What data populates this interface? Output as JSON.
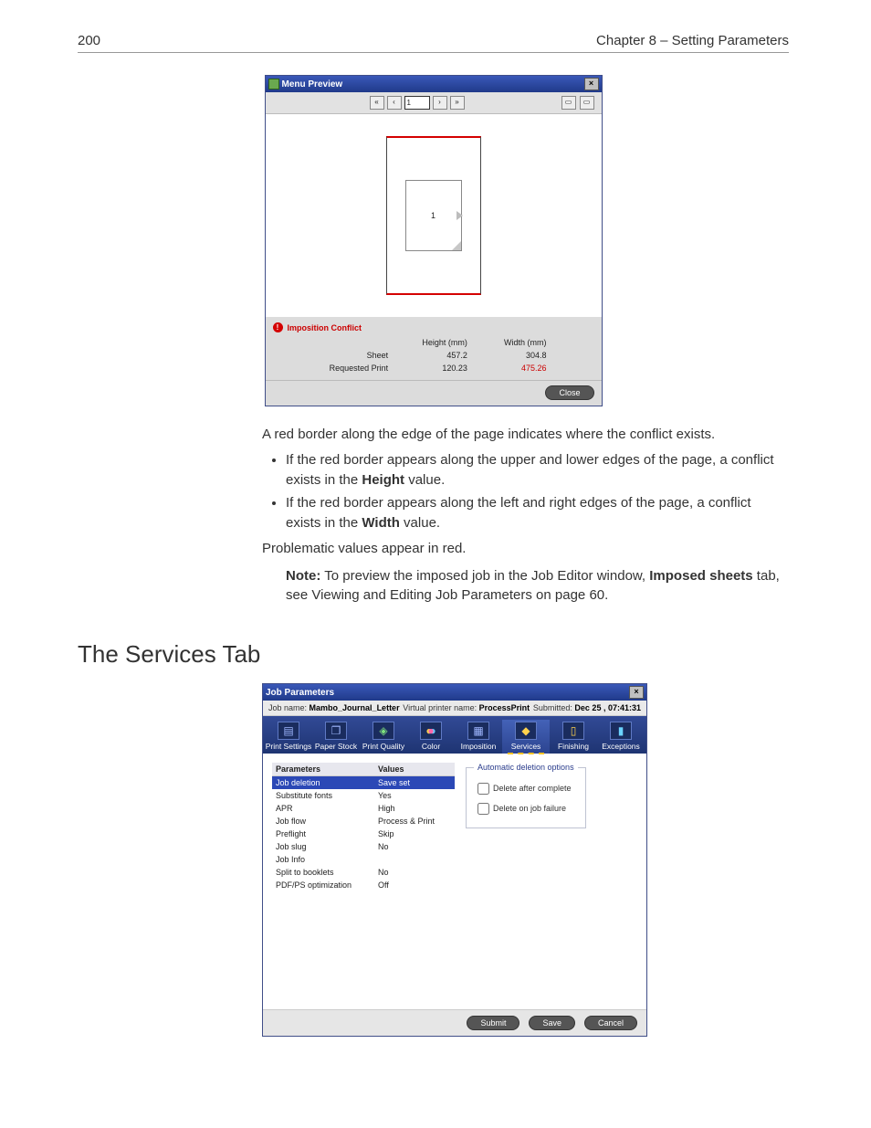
{
  "header": {
    "page_number": "200",
    "chapter": "Chapter 8 – Setting Parameters"
  },
  "preview": {
    "title": "Menu Preview",
    "page_field": "1",
    "sheet_label": "1",
    "conflict_label": "Imposition Conflict",
    "columns": {
      "h": "Height (mm)",
      "w": "Width (mm)"
    },
    "rows": {
      "sheet": {
        "label": "Sheet",
        "h": "457.2",
        "w": "304.8"
      },
      "requested": {
        "label": "Requested Print",
        "h": "120.23",
        "w": "475.26"
      }
    },
    "close": "Close"
  },
  "body": {
    "p1": "A red border along the edge of the page indicates where the conflict exists.",
    "b1a": "If the red border appears along the upper and lower edges of the page, a conflict exists in the ",
    "b1b": "Height",
    "b1c": " value.",
    "b2a": "If the red border appears along the left and right edges of the page, a conflict exists in the ",
    "b2b": "Width",
    "b2c": " value.",
    "p2": "Problematic values appear in red.",
    "note_lead": "Note:",
    "note_a": "  To preview the imposed job in the Job Editor window, ",
    "note_b": "Imposed sheets",
    "note_c": " tab, see Viewing and Editing Job Parameters on page 60."
  },
  "section_heading": "The Services Tab",
  "params": {
    "title": "Job Parameters",
    "info": {
      "jobname_lbl": "Job name:",
      "jobname": "Mambo_Journal_Letter",
      "vp_lbl": "Virtual printer name:",
      "vp": "ProcessPrint",
      "sub_lbl": "Submitted:",
      "sub": "Dec 25 , 07:41:31"
    },
    "tabs": [
      "Print Settings",
      "Paper Stock",
      "Print Quality",
      "Color",
      "Imposition",
      "Services",
      "Finishing",
      "Exceptions"
    ],
    "table": {
      "head_p": "Parameters",
      "head_v": "Values",
      "rows": [
        {
          "p": "Job deletion",
          "v": "Save set",
          "sel": true
        },
        {
          "p": "Substitute fonts",
          "v": "Yes"
        },
        {
          "p": "APR",
          "v": "High"
        },
        {
          "p": "Job flow",
          "v": "Process & Print"
        },
        {
          "p": "Preflight",
          "v": "Skip"
        },
        {
          "p": "Job slug",
          "v": "No"
        },
        {
          "p": "Job Info",
          "v": ""
        },
        {
          "p": "Split to booklets",
          "v": "No"
        },
        {
          "p": "PDF/PS optimization",
          "v": "Off"
        }
      ]
    },
    "options": {
      "legend": "Automatic deletion options",
      "opt1": "Delete after complete",
      "opt2": "Delete on job failure"
    },
    "buttons": {
      "submit": "Submit",
      "save": "Save",
      "cancel": "Cancel"
    }
  }
}
